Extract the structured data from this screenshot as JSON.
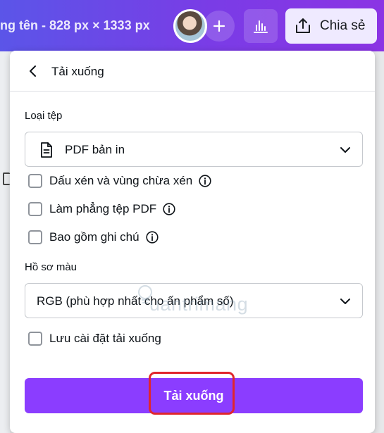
{
  "header": {
    "doc_title": "ng tên - 828 px × 1333 px",
    "share_label": "Chia sẻ",
    "icons": {
      "add": "plus-icon",
      "stats": "bar-chart-icon",
      "share": "share-upload-icon"
    }
  },
  "panel": {
    "title": "Tải xuống",
    "file_type": {
      "label": "Loại tệp",
      "selected": "PDF bản in"
    },
    "options": [
      {
        "label": "Dấu xén và vùng chừa xén",
        "checked": false,
        "has_info": true
      },
      {
        "label": "Làm phẳng tệp PDF",
        "checked": false,
        "has_info": true
      },
      {
        "label": "Bao gồm ghi chú",
        "checked": false,
        "has_info": true
      }
    ],
    "color_profile": {
      "label": "Hồ sơ màu",
      "selected": "RGB (phù hợp nhất cho ấn phẩm số)"
    },
    "save_settings": {
      "label": "Lưu cài đặt tải xuống",
      "checked": false
    },
    "download_label": "Tải xuống"
  },
  "colors": {
    "accent": "#8b3dff",
    "highlight": "#e0262d",
    "header_start": "#5b55e8",
    "header_end": "#8b34e4"
  },
  "watermark": {
    "text": "uantrimang"
  }
}
